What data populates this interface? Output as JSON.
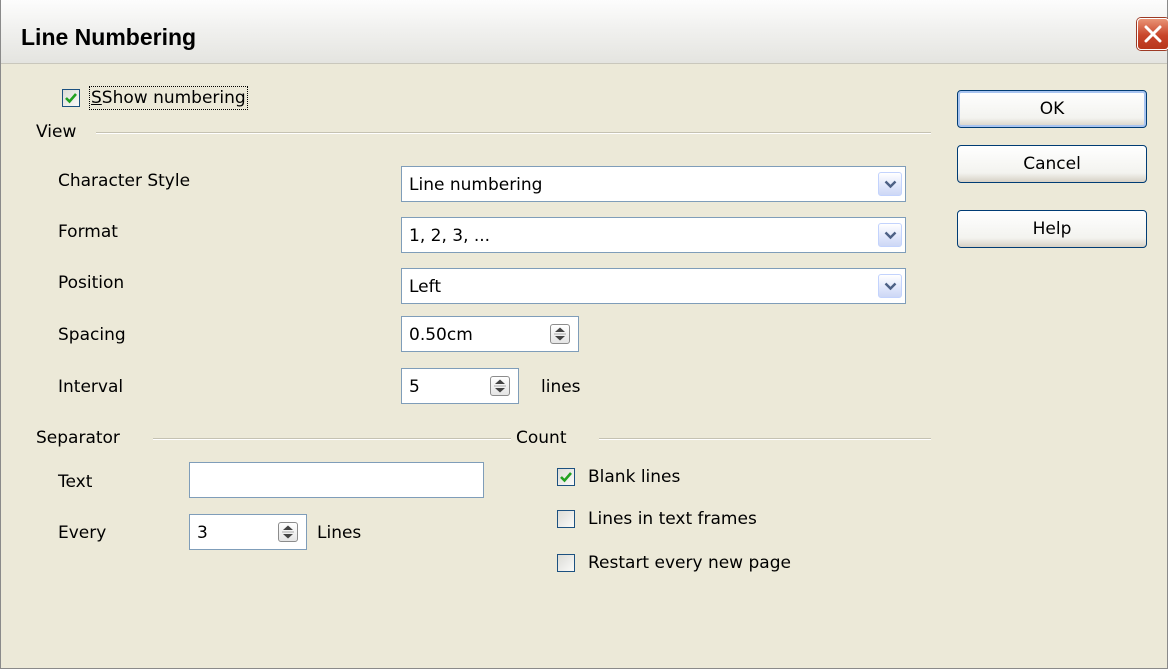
{
  "title": "Line Numbering",
  "show_numbering": {
    "label": "Show numbering",
    "checked": true
  },
  "view": {
    "heading": "View",
    "character_style": {
      "label": "Character Style",
      "value": "Line numbering"
    },
    "format": {
      "label": "Format",
      "value": "1, 2, 3, ..."
    },
    "position": {
      "label": "Position",
      "value": "Left"
    },
    "spacing": {
      "label": "Spacing",
      "value": "0.50cm"
    },
    "interval": {
      "label": "Interval",
      "value": "5",
      "unit": "lines"
    }
  },
  "separator": {
    "heading": "Separator",
    "text": {
      "label": "Text",
      "value": ""
    },
    "every": {
      "label": "Every",
      "value": "3",
      "unit": "Lines"
    }
  },
  "count": {
    "heading": "Count",
    "blank_lines": {
      "label": "Blank lines",
      "checked": true
    },
    "lines_in_text_frames": {
      "label": "Lines in text frames",
      "checked": false
    },
    "restart_every_new_page": {
      "label": "Restart every new page",
      "checked": false
    }
  },
  "buttons": {
    "ok": "OK",
    "cancel": "Cancel",
    "help": "Help"
  },
  "colors": {
    "title_bar": "#f1f1ef",
    "dialog_bg": "#ece9d8",
    "close_red": "#c8452a",
    "check_green": "#21a121",
    "button_border": "#003c74"
  },
  "icons": [
    "close-icon",
    "check-icon",
    "chevron-down-icon",
    "spin-arrows-icon"
  ]
}
